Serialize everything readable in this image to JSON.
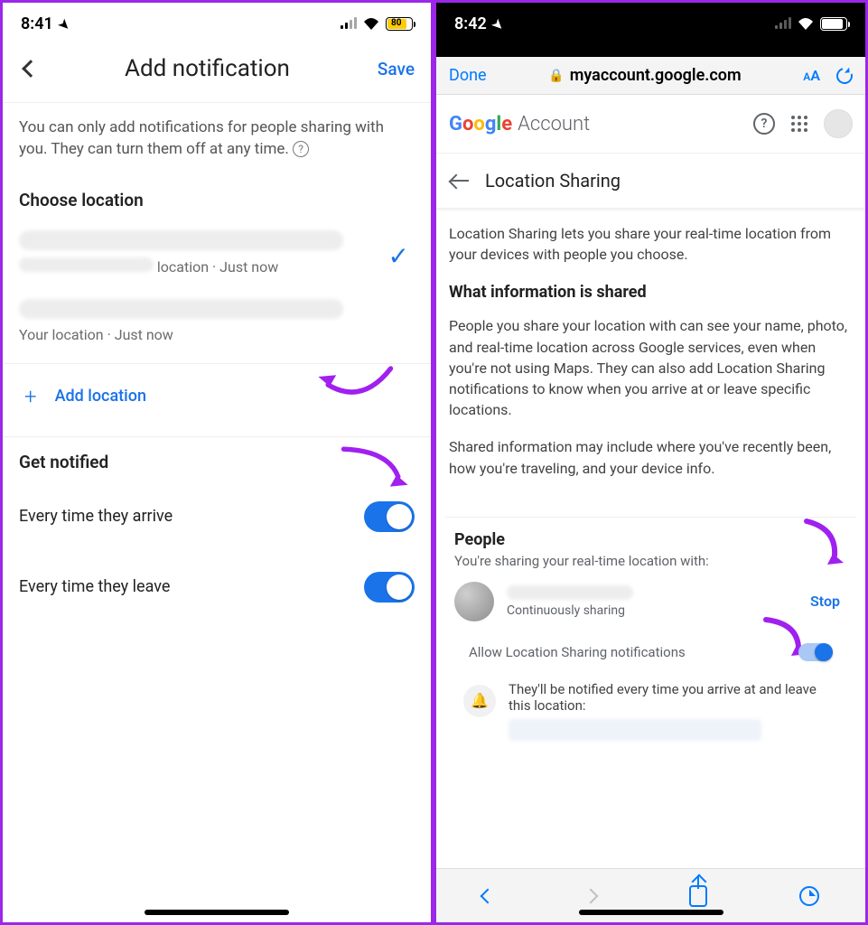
{
  "left": {
    "status": {
      "time": "8:41",
      "battery": "80"
    },
    "header": {
      "title": "Add notification",
      "save": "Save"
    },
    "info": "You can only add notifications for people sharing with you. They can turn them off at any time.",
    "choose_location": "Choose location",
    "loc1_sub": "location · Just now",
    "loc2_sub": "Your location · Just now",
    "add_location": "Add location",
    "get_notified": "Get notified",
    "arrive": "Every time they arrive",
    "leave": "Every time they leave"
  },
  "right": {
    "status": {
      "time": "8:42"
    },
    "safari": {
      "done": "Done",
      "url": "myaccount.google.com",
      "aa": "AA"
    },
    "google": "Google",
    "account": "Account",
    "ls_title": "Location Sharing",
    "intro": "Location Sharing lets you share your real-time location from your devices with people you choose.",
    "what_shared": "What information is shared",
    "shared_p1": "People you share your location with can see your name, photo, and real-time location across Google services, even when you're not using Maps. They can also add Location Sharing notifications to know when you arrive at or leave specific locations.",
    "shared_p2": "Shared information may include where you've recently been, how you're traveling, and your device info.",
    "people": "People",
    "people_sub": "You're sharing your real-time location with:",
    "cont_sharing": "Continuously sharing",
    "stop": "Stop",
    "allow_label": "Allow Location Sharing notifications",
    "notif_text": "They'll be notified every time you arrive at and leave this location:"
  }
}
